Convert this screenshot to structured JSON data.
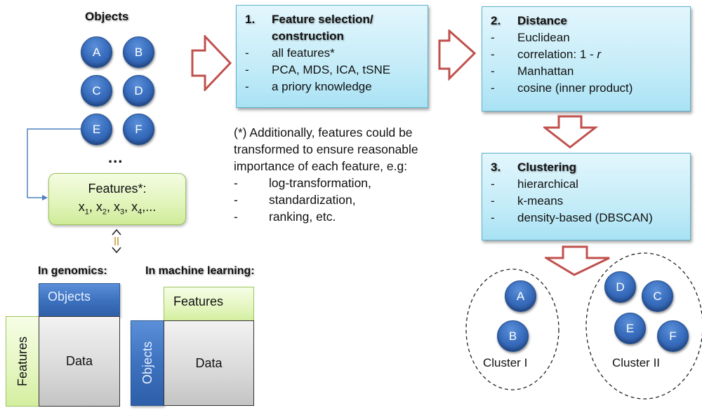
{
  "objects": {
    "title": "Objects",
    "nodes": [
      "A",
      "B",
      "C",
      "D",
      "E",
      "F"
    ],
    "ellipsis": "..."
  },
  "features_box": {
    "line1": "Features*:",
    "vars": [
      {
        "base": "x",
        "sub": "1"
      },
      {
        "base": "x",
        "sub": "2"
      },
      {
        "base": "x",
        "sub": "3"
      },
      {
        "base": "x",
        "sub": "4"
      }
    ],
    "trail": ",..."
  },
  "equivalence_symbol": "⇕",
  "genomics": {
    "title": "In genomics:",
    "top_label": "Objects",
    "side_label": "Features",
    "center_label": "Data"
  },
  "machine_learning": {
    "title": "In machine learning:",
    "top_label": "Features",
    "side_label": "Objects",
    "center_label": "Data"
  },
  "step1": {
    "number": "1.",
    "title_line1": "Feature selection/",
    "title_line2": "construction",
    "items": [
      "all features*",
      "PCA, MDS, ICA, tSNE",
      "a priory knowledge"
    ]
  },
  "footnote": {
    "lines": [
      "(*) Additionally, features could be",
      "transformed to ensure reasonable",
      "importance of each feature, e.g:"
    ],
    "items": [
      "log-transformation,",
      "standardization,",
      "ranking, etc."
    ]
  },
  "step2": {
    "number": "2.",
    "title": "Distance",
    "items": [
      "Euclidean",
      "correlation: 1 - ",
      "Manhattan",
      "cosine (inner product)"
    ],
    "italic_r": "r"
  },
  "step3": {
    "number": "3.",
    "title": "Clustering",
    "items": [
      "hierarchical",
      "k-means",
      "density-based (DBSCAN)"
    ]
  },
  "clusters": [
    {
      "label": "Cluster I",
      "nodes": [
        "A",
        "B"
      ]
    },
    {
      "label": "Cluster II",
      "nodes": [
        "D",
        "C",
        "E",
        "F"
      ]
    }
  ],
  "dash_char": "-",
  "colors": {
    "arrow_outline": "#c0504d",
    "node_blue": "#3a6fc0",
    "step_box": "#c4ecf8",
    "feature_green": "#e4f6c0",
    "connector": "#4f81bd"
  }
}
